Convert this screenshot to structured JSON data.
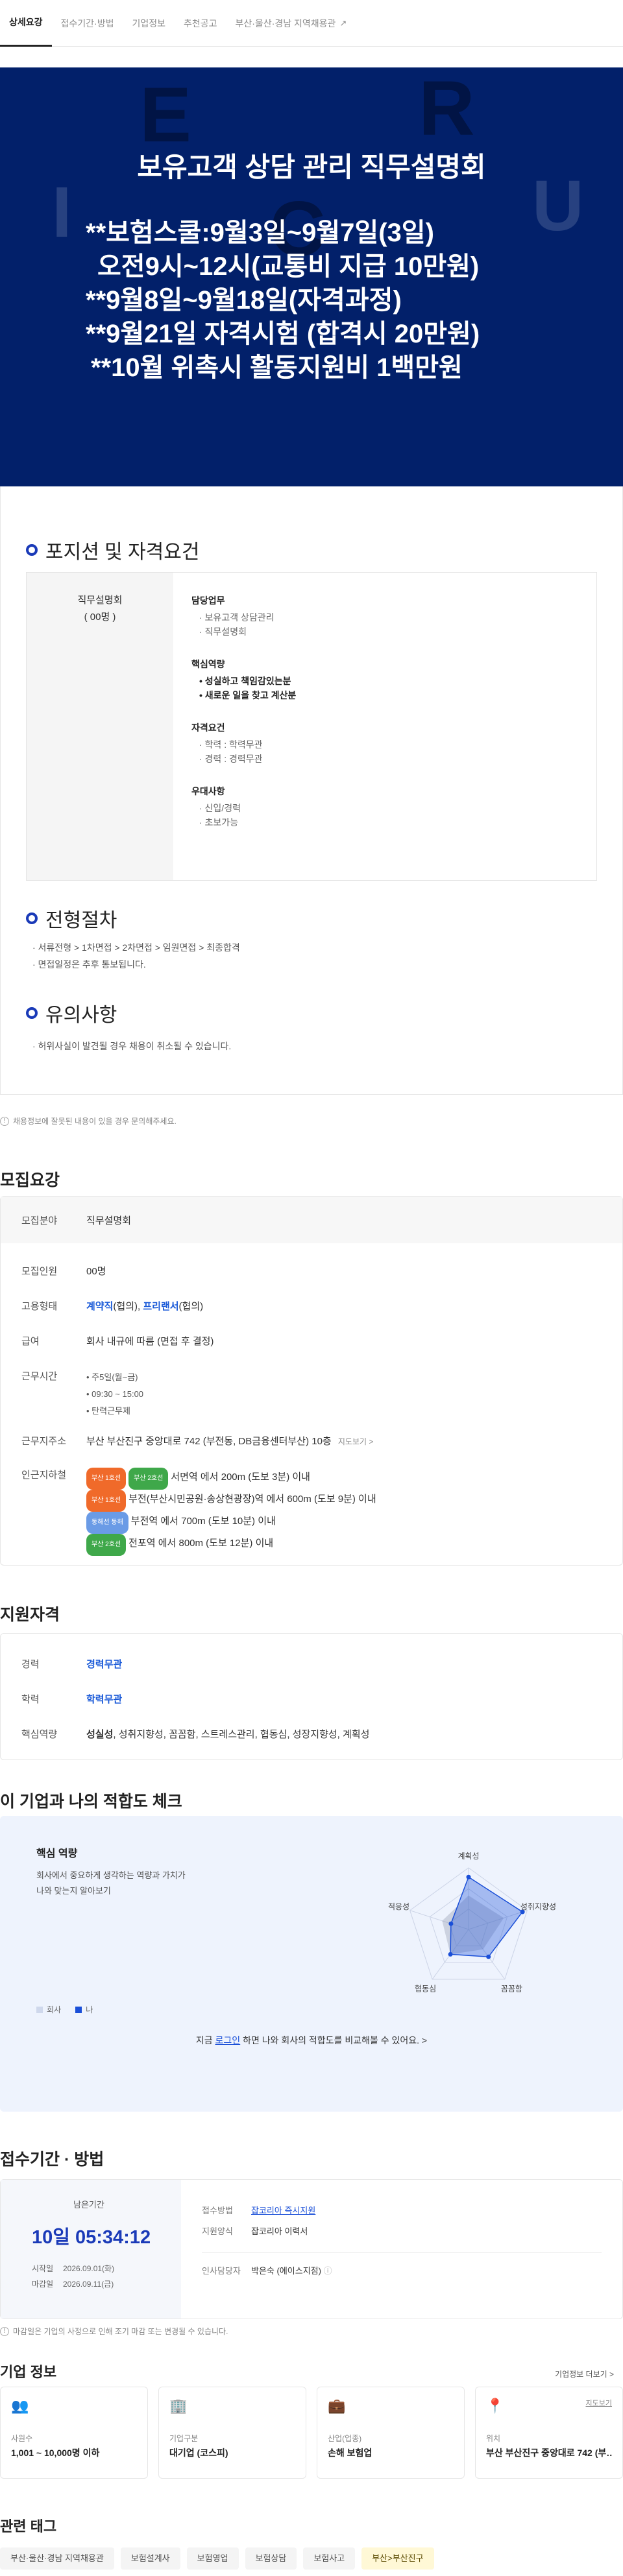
{
  "tabs": [
    {
      "label": "상세요강"
    },
    {
      "label": "접수기간·방법"
    },
    {
      "label": "기업정보"
    },
    {
      "label": "추천공고"
    },
    {
      "label": "부산·울산·경남 지역채용관"
    }
  ],
  "hero": {
    "title": "보유고객 상담 관리 직무설명회",
    "lines": [
      "**보험스쿨:9월3일~9월7일(3일)",
      "오전9시~12시(교통비 지급 10만원)",
      "**9월8일~9월18일(자격과정)",
      "**9월21일 자격시험 (합격시 20만원)",
      "**10월 위촉시 활동지원비 1백만원"
    ]
  },
  "position": {
    "heading": "포지션 및 자격요건",
    "role": "직무설명회",
    "count": "( 00명 )",
    "duties_title": "담당업무",
    "duties": [
      "· 보유고객 상담관리",
      "· 직무설명회"
    ],
    "core_title": "핵심역량",
    "core": [
      "• 성실하고 책임감있는분",
      "• 새로운 일을 찾고 계산분"
    ],
    "qual_title": "자격요건",
    "qual": [
      "· 학력 : 학력무관",
      "· 경력 : 경력무관"
    ],
    "pref_title": "우대사항",
    "pref": [
      "· 신입/경력",
      "· 초보가능"
    ]
  },
  "process": {
    "heading": "전형절차",
    "line1": "· 서류전형 > 1차면접 > 2차면접 > 임원면접 > 최종합격",
    "line2": "· 면접일정은 추후 통보됩니다."
  },
  "caution": {
    "heading": "유의사항",
    "line1": "· 허위사실이 발견될 경우 채용이 취소될 수 있습니다."
  },
  "notice1": "채용정보에 잘못된 내용이 있을 경우 문의해주세요.",
  "recruit": {
    "heading": "모집요강",
    "field_label": "모집분야",
    "field_value": "직무설명회",
    "count_label": "모집인원",
    "count_value": "00명",
    "emp_label": "고용형태",
    "emp_value1": "계약직",
    "emp_value1_note": "(협의), ",
    "emp_value2": "프리랜서",
    "emp_value2_note": "(협의)",
    "salary_label": "급여",
    "salary_value": "회사 내규에 따름 (면접 후 결정)",
    "hours_label": "근무시간",
    "hours": [
      "• 주5일(월~금)",
      "• 09:30 ~ 15:00",
      "• 탄력근무제"
    ],
    "addr_label": "근무지주소",
    "addr_value": "부산 부산진구 중앙대로 742 (부전동, DB금융센터부산) 10층",
    "addr_map": "지도보기 >",
    "subway_label": "인근지하철",
    "subway": [
      {
        "badges": [
          {
            "text": "부산 1호선",
            "color": "#f06a2a"
          },
          {
            "text": "부산 2호선",
            "color": "#3fa84a"
          }
        ],
        "text": "서면역 에서 200m (도보 3분) 이내"
      },
      {
        "badges": [
          {
            "text": "부산 1호선",
            "color": "#f06a2a"
          }
        ],
        "text": "부전(부산시민공원·송상현광장)역 에서 600m (도보 9분) 이내"
      },
      {
        "badges": [
          {
            "text": "동해선 동해",
            "color": "#6a9be6"
          }
        ],
        "text": "부전역 에서 700m (도보 10분) 이내"
      },
      {
        "badges": [
          {
            "text": "부산 2호선",
            "color": "#3fa84a"
          }
        ],
        "text": "전포역 에서 800m (도보 12분) 이내"
      }
    ]
  },
  "qualify": {
    "heading": "지원자격",
    "exp_label": "경력",
    "exp_value": "경력무관",
    "edu_label": "학력",
    "edu_value": "학력무관",
    "core_label": "핵심역량",
    "core_value_bold": "성실성",
    "core_value_rest": ", 성취지향성, 꼼꼼함, 스트레스관리, 협동심, 성장지향성, 계획성"
  },
  "fit": {
    "heading": "이 기업과 나의 적합도 체크",
    "title": "핵심 역량",
    "desc1": "회사에서 중요하게 생각하는 역량과 가치가",
    "desc2": "나와 맞는지 알아보기",
    "legend_company": "회사",
    "legend_me": "나",
    "axes": [
      "계획성",
      "성취지향성",
      "꼼꼼함",
      "협동심",
      "적응성"
    ],
    "company_values": [
      0.55,
      0.6,
      0.4,
      0.5,
      0.45
    ],
    "me_values": [
      0.85,
      0.92,
      0.55,
      0.5,
      0.3
    ],
    "login_pre": "지금 ",
    "login_link": "로그인",
    "login_post": " 하면 나와 회사의 적합도를 비교해볼 수 있어요. >"
  },
  "apply": {
    "heading": "접수기간 · 방법",
    "remain_label": "남은기간",
    "remain_value": "10일 05:34:12",
    "start_label": "시작일",
    "start_value": "2026.09.01(화)",
    "end_label": "마감일",
    "end_value": "2026.09.11(금)",
    "method_label": "접수방법",
    "method_value": "잡코리아 즉시지원",
    "form_label": "지원양식",
    "form_value": "잡코리아 이력서",
    "hr_label": "인사담당자",
    "hr_value": "박은숙 (에이스지점)",
    "note": "마감일은 기업의 사정으로 인해 조기 마감 또는 변경될 수 있습니다."
  },
  "company": {
    "heading": "기업 정보",
    "more": "기업정보 더보기 >",
    "cards": [
      {
        "icon": "people-icon",
        "label": "사원수",
        "value": "1,001 ~ 10,000명 이하"
      },
      {
        "icon": "building-icon",
        "label": "기업구분",
        "value": "대기업 (코스피)"
      },
      {
        "icon": "briefcase-icon",
        "label": "산업(업종)",
        "value": "손해 보험업"
      },
      {
        "icon": "pin-icon",
        "label": "위치",
        "value": "부산 부산진구 중앙대로 742 (부…",
        "extra": "지도보기"
      }
    ]
  },
  "tags": {
    "heading": "관련 태그",
    "items": [
      "부산·울산·경남 지역채용관",
      "보험설계사",
      "보험영업",
      "보험상담",
      "보험사고",
      "부산>부산진구"
    ]
  }
}
